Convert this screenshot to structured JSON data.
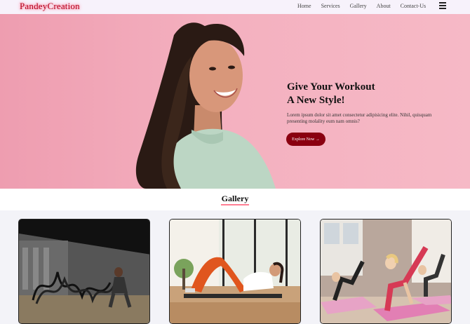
{
  "navbar": {
    "brand": "PandeyCreation",
    "links": [
      "Home",
      "Services",
      "Gallery",
      "About",
      "Contact-Us"
    ],
    "menu_icon": "hamburger-menu-icon"
  },
  "hero": {
    "title_line1": "Give Your Workout",
    "title_line2": "A New Style!",
    "text": "Lorem ipsum dolor sit amet consectetur adipisicing elite. Nihil, quisquam presenting molality eum nam omnis?",
    "button_label": "Explore Now →",
    "background_color": "#f4b0bf",
    "button_color": "#8a0010"
  },
  "gallery": {
    "title": "Gallery",
    "images": [
      "battle-ropes-workout-photo",
      "abs-crunch-workout-photo",
      "group-fitness-workout-photo"
    ]
  },
  "colors": {
    "brand": "#b3001b",
    "accent_underline": "#ff7f93"
  }
}
